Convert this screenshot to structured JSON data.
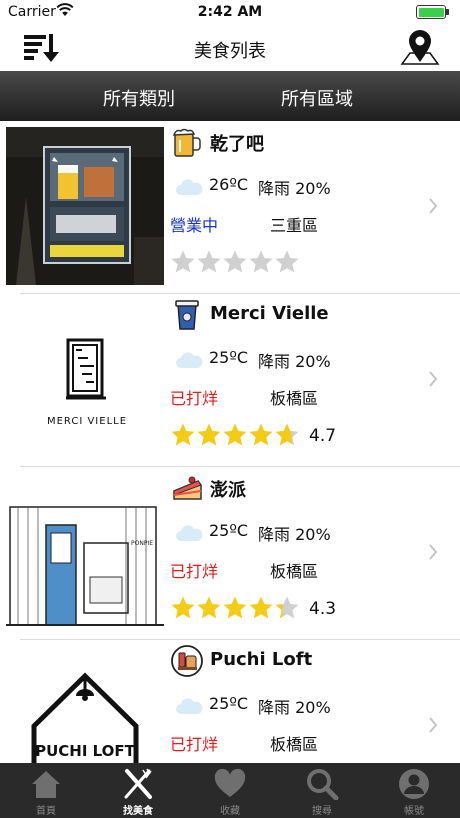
{
  "status_bar": {
    "carrier": "Carrier",
    "time": "2:42 AM"
  },
  "nav": {
    "title": "美食列表",
    "left_icon": "sort-descending-icon",
    "right_icon": "map-pin-icon"
  },
  "filters": {
    "category": "所有類別",
    "area": "所有區域"
  },
  "colors": {
    "open": "#1a35c8",
    "closed": "#e21b1b",
    "star_filled": "#f5cc15",
    "star_empty": "#d0d0d0",
    "tabbar": "#2a2a2a"
  },
  "restaurants": [
    {
      "name": "乾了吧",
      "type_icon": "beer-mug-icon",
      "temp": "26ºC",
      "rain": "降雨 20%",
      "status": "營業中",
      "status_open": true,
      "district": "三重區",
      "rating_value": 0,
      "rating_text": ""
    },
    {
      "name": "Merci Vielle",
      "type_icon": "coffee-cup-icon",
      "temp": "25ºC",
      "rain": "降雨 20%",
      "status": "已打烊",
      "status_open": false,
      "district": "板橋區",
      "rating_value": 4.7,
      "rating_text": "4.7",
      "logo_text": "MERCI VIELLE"
    },
    {
      "name": "澎派",
      "type_icon": "cake-icon",
      "temp": "25ºC",
      "rain": "降雨 20%",
      "status": "已打烊",
      "status_open": false,
      "district": "板橋區",
      "rating_value": 4.3,
      "rating_text": "4.3",
      "logo_text": "PONPIE"
    },
    {
      "name": "Puchi Loft",
      "type_icon": "snack-plate-icon",
      "temp": "25ºC",
      "rain": "降雨 20%",
      "status": "已打烊",
      "status_open": false,
      "district": "板橋區",
      "rating_value": 0,
      "rating_text": "",
      "logo_text": "PUCHI LOFT"
    }
  ],
  "tabs": [
    {
      "label": "首頁",
      "icon": "home-icon",
      "active": false
    },
    {
      "label": "找美食",
      "icon": "fork-knife-icon",
      "active": true
    },
    {
      "label": "收藏",
      "icon": "heart-icon",
      "active": false
    },
    {
      "label": "搜尋",
      "icon": "magnifier-icon",
      "active": false
    },
    {
      "label": "帳號",
      "icon": "user-icon",
      "active": false
    }
  ]
}
